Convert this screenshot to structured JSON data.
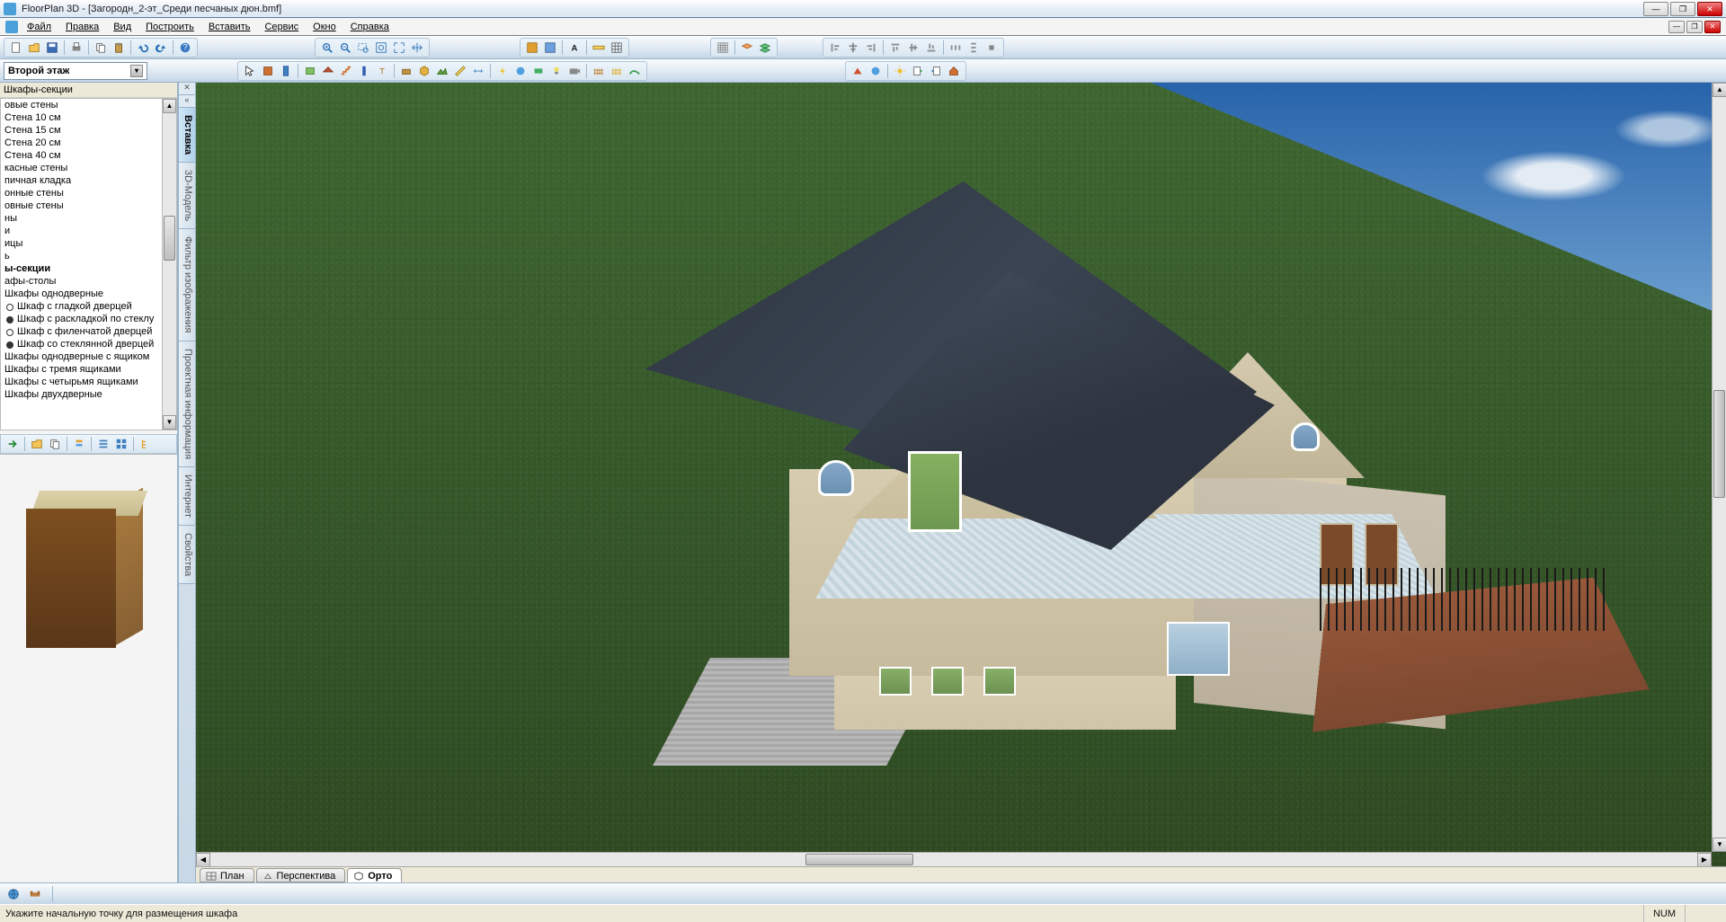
{
  "title": "FloorPlan 3D - [Загородн_2-эт_Среди песчаных дюн.bmf]",
  "menu": {
    "file": "Файл",
    "edit": "Правка",
    "view": "Вид",
    "build": "Построить",
    "insert": "Вставить",
    "service": "Сервис",
    "window": "Окно",
    "help": "Справка"
  },
  "floor_selector": "Второй этаж",
  "panel": {
    "title": "Шкафы-секции",
    "items": [
      {
        "label": "овые стены"
      },
      {
        "label": "Стена 10 см"
      },
      {
        "label": "Стена 15 см"
      },
      {
        "label": "Стена 20 см"
      },
      {
        "label": "Стена 40 см"
      },
      {
        "label": "касные стены"
      },
      {
        "label": "пичная кладка"
      },
      {
        "label": "онные стены"
      },
      {
        "label": "овные стены"
      },
      {
        "label": "ны"
      },
      {
        "label": "и"
      },
      {
        "label": "ицы"
      },
      {
        "label": "ь"
      },
      {
        "label": "ы-секции",
        "bold": true
      },
      {
        "label": "афы-столы"
      },
      {
        "label": "Шкафы однодверные"
      },
      {
        "label": "Шкаф с гладкой дверцей",
        "sub": true,
        "filled": false
      },
      {
        "label": "Шкаф с раскладкой по стеклу",
        "sub": true,
        "filled": true
      },
      {
        "label": "Шкаф с филенчатой дверцей",
        "sub": true,
        "filled": false
      },
      {
        "label": "Шкаф со стеклянной дверцей",
        "sub": true,
        "filled": true
      },
      {
        "label": "Шкафы однодверные с ящиком"
      },
      {
        "label": "Шкафы с тремя ящиками"
      },
      {
        "label": "Шкафы с четырьмя ящиками"
      },
      {
        "label": "Шкафы двухдверные"
      }
    ]
  },
  "side_tabs": [
    "Вставка",
    "3D-Модель",
    "Фильтр изображения",
    "Проектная информация",
    "Интернет",
    "Свойства"
  ],
  "view_tabs": {
    "plan": "План",
    "perspective": "Перспектива",
    "ortho": "Орто"
  },
  "status": {
    "hint": "Укажите начальную точку для размещения шкафа",
    "num": "NUM"
  }
}
